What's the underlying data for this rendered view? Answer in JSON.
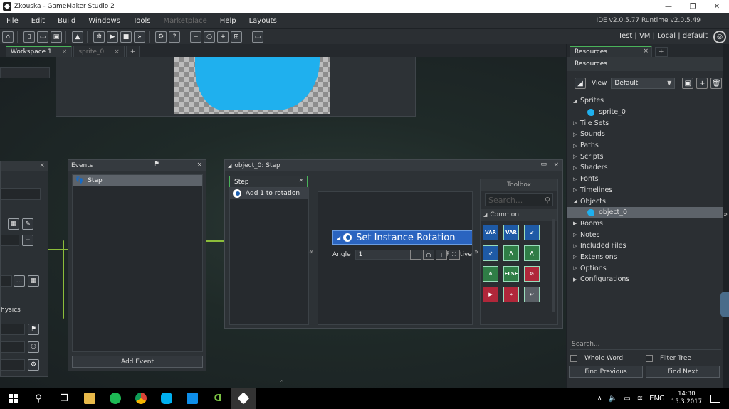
{
  "window": {
    "title": "Zkouska - GameMaker Studio 2",
    "controls": {
      "minimize": "—",
      "maximize": "❐",
      "close": "✕"
    }
  },
  "menubar": {
    "items": [
      "File",
      "Edit",
      "Build",
      "Windows",
      "Tools",
      "Marketplace",
      "Help",
      "Layouts"
    ],
    "disabled_item": "Marketplace",
    "version": "IDE v2.0.5.77  Runtime v2.0.5.49"
  },
  "toolbar": {
    "targets": "Test | VM | Local | default"
  },
  "workspace_tabs": {
    "active": "Workspace 1",
    "inactive": "sprite_0",
    "close": "×",
    "add": "+"
  },
  "left_panel": {
    "label": "hysics",
    "button_dots": "...",
    "button_minus": "−"
  },
  "events": {
    "title": "Events",
    "items": [
      "Step"
    ],
    "add_button": "Add Event",
    "close": "×"
  },
  "step_window": {
    "title": "object_0: Step",
    "tab": "Step",
    "actions": [
      "Add 1 to rotation"
    ],
    "node": {
      "title": "Set Instance Rotation",
      "field_label": "Angle",
      "field_value": "1",
      "relative_label": "Relative"
    },
    "toolbox": {
      "title": "Toolbox",
      "search_placeholder": "Search...",
      "section": "Common",
      "tiles": [
        {
          "label": "VAR",
          "color": "blue"
        },
        {
          "label": "VAR",
          "color": "blue"
        },
        {
          "label": "",
          "color": "blue"
        },
        {
          "label": "",
          "color": "blue"
        },
        {
          "label": "",
          "color": "green"
        },
        {
          "label": "",
          "color": "green"
        },
        {
          "label": "",
          "color": "green"
        },
        {
          "label": "ELSE",
          "color": "green"
        },
        {
          "label": "",
          "color": "red"
        },
        {
          "label": "",
          "color": "red"
        },
        {
          "label": "",
          "color": "red"
        },
        {
          "label": "",
          "color": "gray"
        }
      ]
    }
  },
  "resources": {
    "tab": "Resources",
    "header": "Resources",
    "view_label": "View",
    "view_value": "Default",
    "tree": [
      {
        "label": "Sprites",
        "expanded": true,
        "children": [
          "sprite_0"
        ]
      },
      {
        "label": "Tile Sets"
      },
      {
        "label": "Sounds"
      },
      {
        "label": "Paths"
      },
      {
        "label": "Scripts"
      },
      {
        "label": "Shaders"
      },
      {
        "label": "Fonts"
      },
      {
        "label": "Timelines"
      },
      {
        "label": "Objects",
        "expanded": true,
        "children": [
          "object_0"
        ]
      },
      {
        "label": "Rooms"
      },
      {
        "label": "Notes"
      },
      {
        "label": "Included Files"
      },
      {
        "label": "Extensions"
      },
      {
        "label": "Options"
      },
      {
        "label": "Configurations"
      }
    ],
    "search_placeholder": "Search...",
    "whole_word": "Whole Word",
    "filter_tree": "Filter Tree",
    "find_previous": "Find Previous",
    "find_next": "Find Next"
  },
  "taskbar": {
    "lang": "ENG",
    "time": "14:30",
    "date": "15.3.2017"
  },
  "colors": {
    "accent_green": "#4ab35a",
    "sprite_blue": "#1fb0ee",
    "node_blue": "#2a64c0"
  }
}
